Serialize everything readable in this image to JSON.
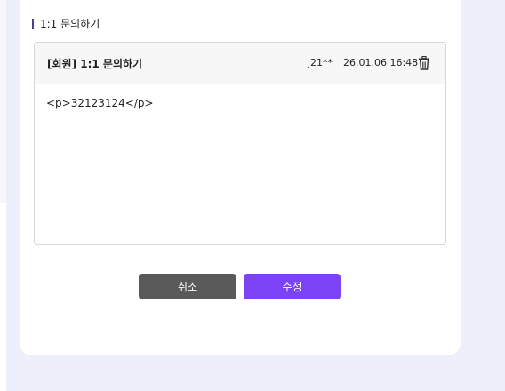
{
  "section": {
    "title": "1:1 문의하기"
  },
  "post": {
    "title": "[회원] 1:1 문의하기",
    "author": "j21**",
    "date": "26.01.06 16:48",
    "body": "<p>32123124</p>"
  },
  "buttons": {
    "cancel": "취소",
    "edit": "수정"
  },
  "colors": {
    "accent": "#7b42f6",
    "cancel": "#5a5a5a",
    "background": "#edf0fb"
  },
  "icons": {
    "delete": "trash-icon"
  }
}
